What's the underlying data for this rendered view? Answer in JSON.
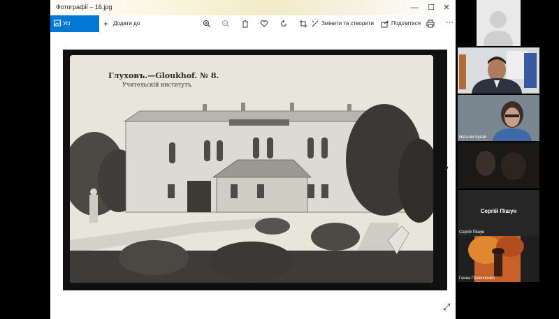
{
  "window": {
    "title": "Фотографії – 16.jpg",
    "controls": [
      "—",
      "☐",
      "✕"
    ]
  },
  "toolbar": {
    "all_photos": "Усі фотографії",
    "add_to": "Додати до",
    "edit_create": "Змінити та створити",
    "share": "Поділитися",
    "icons": [
      "zoom-in-icon",
      "zoom-out-icon",
      "delete-icon",
      "heart-icon",
      "rotate-icon",
      "crop-icon",
      "more-icon",
      "print-icon"
    ]
  },
  "photo": {
    "caption_line1": "Глуховъ.—Gloukhof. № 8.",
    "caption_line2": "Учительскій институтъ.",
    "sign": "УЧИТЕЛЬСКІЙ ИНСТИТУТЪ"
  },
  "participants": [
    {
      "name": ""
    },
    {
      "name": ""
    },
    {
      "name": "Наталія Кугай"
    },
    {
      "name": ""
    },
    {
      "name": "Сергій Пішун",
      "subname": "Сергій Пішун"
    },
    {
      "name": "Ганна Прокопенко"
    }
  ],
  "colors": {
    "accent": "#0078d4",
    "sepia": "#e9e6dc"
  }
}
